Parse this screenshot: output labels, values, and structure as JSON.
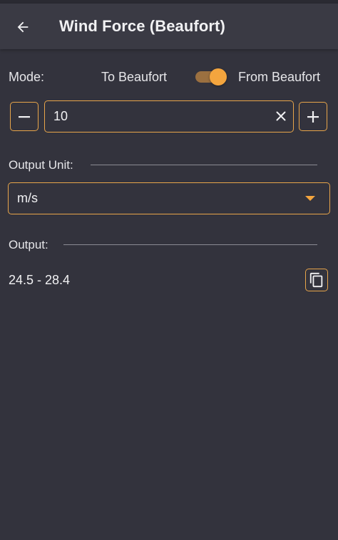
{
  "app_bar": {
    "title": "Wind Force (Beaufort)",
    "back_icon": "arrow-back-icon"
  },
  "mode": {
    "label": "Mode:",
    "option_left": "To Beaufort",
    "option_right": "From Beaufort",
    "toggle_on": true
  },
  "input": {
    "value": "10",
    "decrement_icon": "minus-icon",
    "increment_icon": "plus-icon",
    "clear_icon": "close-icon"
  },
  "output_unit": {
    "label": "Output Unit:",
    "selected": "m/s",
    "dropdown_icon": "triangle-down-icon"
  },
  "output": {
    "label": "Output:",
    "value": "24.5 - 28.4",
    "copy_icon": "copy-icon"
  },
  "colors": {
    "background": "#33333d",
    "app_bar": "#3a3a44",
    "accent": "#f4a53e",
    "border_accent": "#e8a54a",
    "toggle_track": "#9b7040",
    "text": "#ececee"
  }
}
